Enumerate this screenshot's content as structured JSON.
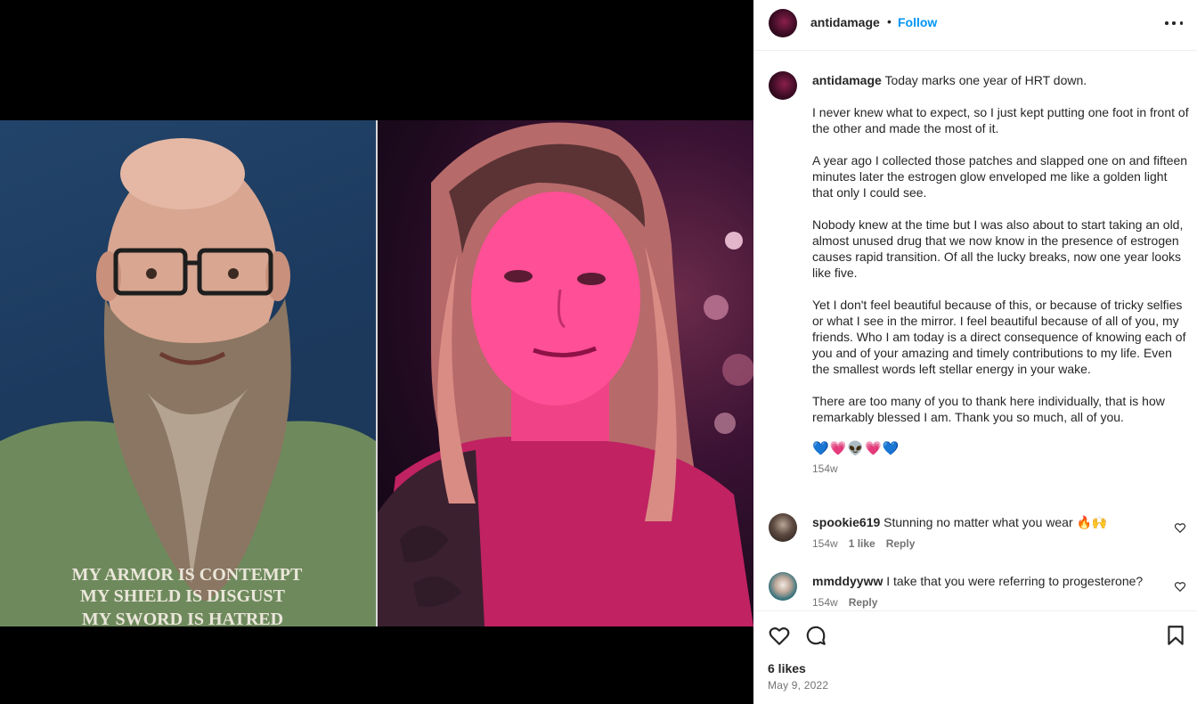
{
  "post": {
    "username": "antidamage",
    "separator": "•",
    "follow_label": "Follow",
    "more_icon": "more-options-icon"
  },
  "media": {
    "left_shirt_text": [
      "MY ARMOR IS CONTEMPT",
      "MY SHIELD IS DISGUST",
      "MY SWORD IS HATRED"
    ]
  },
  "caption": {
    "username": "antidamage",
    "paragraphs": [
      "Today marks one year of HRT down.",
      "I never knew what to expect, so I just kept putting one foot in front of the other and made the most of it.",
      "A year ago I collected those patches and slapped one on and fifteen minutes later the estrogen glow enveloped me like a golden light that only I could see.",
      "Nobody knew at the time but I was also about to start taking an old, almost unused drug that we now know in the presence of estrogen causes rapid transition. Of all the lucky breaks, now one year looks like five.",
      "Yet I don't feel beautiful because of this, or because of tricky selfies or what I see in the mirror. I feel beautiful because of all of you, my friends. Who I am today is a direct consequence of knowing each of you and of your amazing and timely contributions to my life. Even the smallest words left stellar energy in your wake.",
      "There are too many of you to thank here individually, that is how remarkably blessed I am. Thank you so much, all of you."
    ],
    "emojis": "💙💗👽💗💙",
    "time": "154w"
  },
  "comments": [
    {
      "username": "spookie619",
      "text": "Stunning no matter what you wear 🔥🙌",
      "time": "154w",
      "likes": "1 like",
      "reply": "Reply"
    },
    {
      "username": "mmddyyww",
      "text": "I take that you were referring to progesterone?",
      "time": "154w",
      "reply": "Reply"
    }
  ],
  "footer": {
    "likes": "6 likes",
    "date": "May 9, 2022",
    "icons": [
      "heart-icon",
      "comment-icon",
      "bookmark-icon"
    ]
  }
}
